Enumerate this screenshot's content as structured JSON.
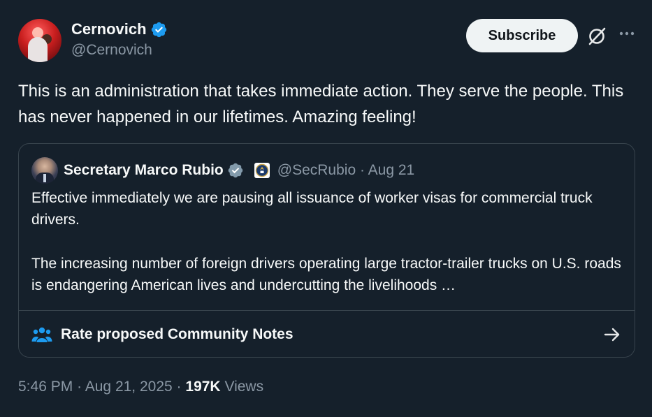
{
  "author": {
    "name": "Cernovich",
    "handle": "@Cernovich"
  },
  "actions": {
    "subscribe_label": "Subscribe"
  },
  "tweet": {
    "text": "This is an administration that takes immediate action. They serve the people. This has never happened in our lifetimes. Amazing feeling!"
  },
  "quote": {
    "name": "Secretary Marco Rubio",
    "handle": "@SecRubio",
    "separator": "·",
    "date": "Aug 21",
    "paragraphs": [
      "Effective immediately we are pausing all issuance of worker visas for commercial truck drivers.",
      "The increasing number of foreign drivers operating large tractor-trailer trucks on U.S. roads is endangering American lives and undercutting the livelihoods …"
    ],
    "notes_label": "Rate proposed Community Notes"
  },
  "meta": {
    "time": "5:46 PM",
    "separator": "·",
    "date": "Aug 21, 2025",
    "views_count": "197K",
    "views_label": "Views"
  },
  "icons": {
    "verified": "verified-badge-icon",
    "grok": "grok-icon",
    "more": "more-icon",
    "seal": "government-seal-icon",
    "notes": "community-notes-icon",
    "arrow": "arrow-right-icon"
  },
  "colors": {
    "background": "#15202b",
    "verified": "#1d9bf0",
    "quote_verified": "#829aab",
    "border": "#38444d",
    "secondary_text": "#8b98a5"
  }
}
